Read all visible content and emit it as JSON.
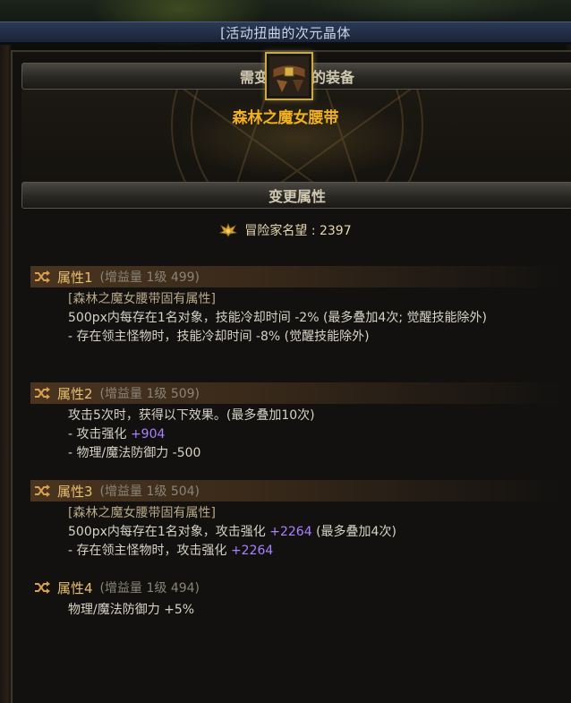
{
  "window": {
    "title": "[活动扭曲的次元晶体"
  },
  "equip_section": {
    "header": "需变更属性的装备",
    "item_name": "森林之魔女腰带",
    "item_icon": "belt-icon"
  },
  "change_section": {
    "header": "变更属性",
    "adventurer_label": "冒险家名望 : 2397"
  },
  "attributes": [
    {
      "name": "属性1",
      "meta": "(增益量 1级 499)",
      "lines": [
        "[森林之魔女腰带固有属性]",
        "500px内每存在1名对象，技能冷却时间 -2% (最多叠加4次; 觉醒技能除外)",
        "- 存在领主怪物时，技能冷却时间 -8% (觉醒技能除外)"
      ]
    },
    {
      "name": "属性2",
      "meta": "(增益量 1级 509)",
      "lines": [
        "攻击5次时，获得以下效果。(最多叠加10次)",
        "- 攻击强化 ",
        "+904",
        "- 物理/魔法防御力 -500"
      ]
    },
    {
      "name": "属性3",
      "meta": "(增益量 1级 504)",
      "lines": [
        "[森林之魔女腰带固有属性]",
        "500px内每存在1名对象，攻击强化 ",
        "+2264",
        " (最多叠加4次)",
        "- 存在领主怪物时，攻击强化 ",
        "+2264"
      ]
    },
    {
      "name": "属性4",
      "meta": "(增益量 1级 494)",
      "lines": [
        "物理/魔法防御力 +5%"
      ]
    }
  ],
  "colors": {
    "item_name": "#f0b020",
    "highlight": "#a882ff",
    "attr_name": "#e8c070"
  }
}
